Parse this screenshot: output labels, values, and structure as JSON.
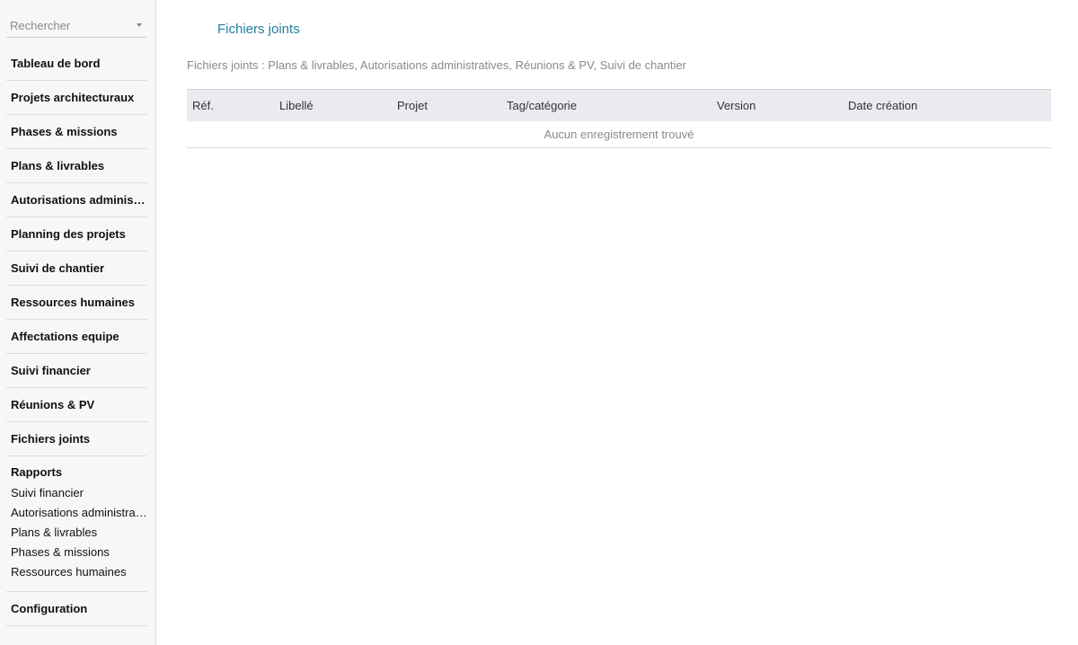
{
  "search": {
    "placeholder": "Rechercher",
    "value": ""
  },
  "sidebar": {
    "items": [
      {
        "label": "Tableau de bord"
      },
      {
        "label": "Projets architecturaux"
      },
      {
        "label": "Phases & missions"
      },
      {
        "label": "Plans & livrables"
      },
      {
        "label": "Autorisations administratives"
      },
      {
        "label": "Planning des projets"
      },
      {
        "label": "Suivi de chantier"
      },
      {
        "label": "Ressources humaines"
      },
      {
        "label": "Affectations equipe"
      },
      {
        "label": "Suivi financier"
      },
      {
        "label": "Réunions & PV"
      },
      {
        "label": "Fichiers joints"
      }
    ],
    "reports": {
      "title": "Rapports",
      "links": [
        {
          "label": "Suivi financier"
        },
        {
          "label": "Autorisations administratives"
        },
        {
          "label": "Plans & livrables"
        },
        {
          "label": "Phases & missions"
        },
        {
          "label": "Ressources humaines"
        }
      ]
    },
    "configuration": {
      "label": "Configuration"
    }
  },
  "main": {
    "title": "Fichiers joints",
    "subtitle": "Fichiers joints : Plans & livrables, Autorisations administratives, Réunions & PV, Suivi de chantier",
    "table": {
      "columns": [
        "Réf.",
        "Libellé",
        "Projet",
        "Tag/catégorie",
        "Version",
        "Date création"
      ],
      "empty_message": "Aucun enregistrement trouvé"
    }
  },
  "colors": {
    "accent": "#1f7f9f",
    "sidebar_bg": "#f7f7f7",
    "table_header_bg": "#eaebef",
    "muted_text": "#8a8a8a"
  },
  "icons": {
    "search_dropdown": "chevron-down-icon"
  }
}
